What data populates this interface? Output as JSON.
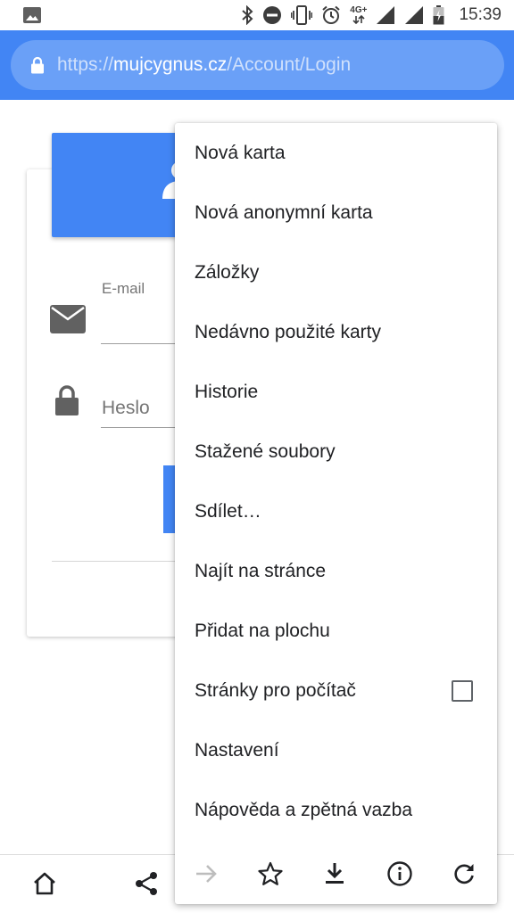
{
  "status_bar": {
    "time": "15:39",
    "network_label": "4G+",
    "icons": [
      "image-icon",
      "bluetooth-icon",
      "do-not-disturb-icon",
      "vibrate-icon",
      "alarm-icon",
      "network-4g-icon",
      "signal-icon",
      "signal-icon",
      "battery-icon"
    ]
  },
  "browser": {
    "url_scheme": "https://",
    "url_domain": "mujcygnus.cz",
    "url_path": "/Account/Login",
    "lock_icon": "lock-icon"
  },
  "page": {
    "email_label": "E-mail",
    "email_icon": "envelope-icon",
    "password_placeholder": "Heslo",
    "password_icon": "lock-icon",
    "header_icon": "person-icon",
    "accent_color": "#4285f4"
  },
  "menu": {
    "items": [
      {
        "label": "Nová karta"
      },
      {
        "label": "Nová anonymní karta"
      },
      {
        "label": "Záložky"
      },
      {
        "label": "Nedávno použité karty"
      },
      {
        "label": "Historie"
      },
      {
        "label": "Stažené soubory"
      },
      {
        "label": "Sdílet…"
      },
      {
        "label": "Najít na stránce"
      },
      {
        "label": "Přidat na plochu"
      },
      {
        "label": "Stránky pro počítač",
        "checkbox": false
      },
      {
        "label": "Nastavení"
      },
      {
        "label": "Nápověda a zpětná vazba"
      }
    ],
    "icon_row": [
      "forward-icon",
      "star-icon",
      "download-icon",
      "info-icon",
      "reload-icon"
    ]
  },
  "bottom_bar": {
    "icons": [
      "home-icon",
      "share-icon"
    ]
  }
}
